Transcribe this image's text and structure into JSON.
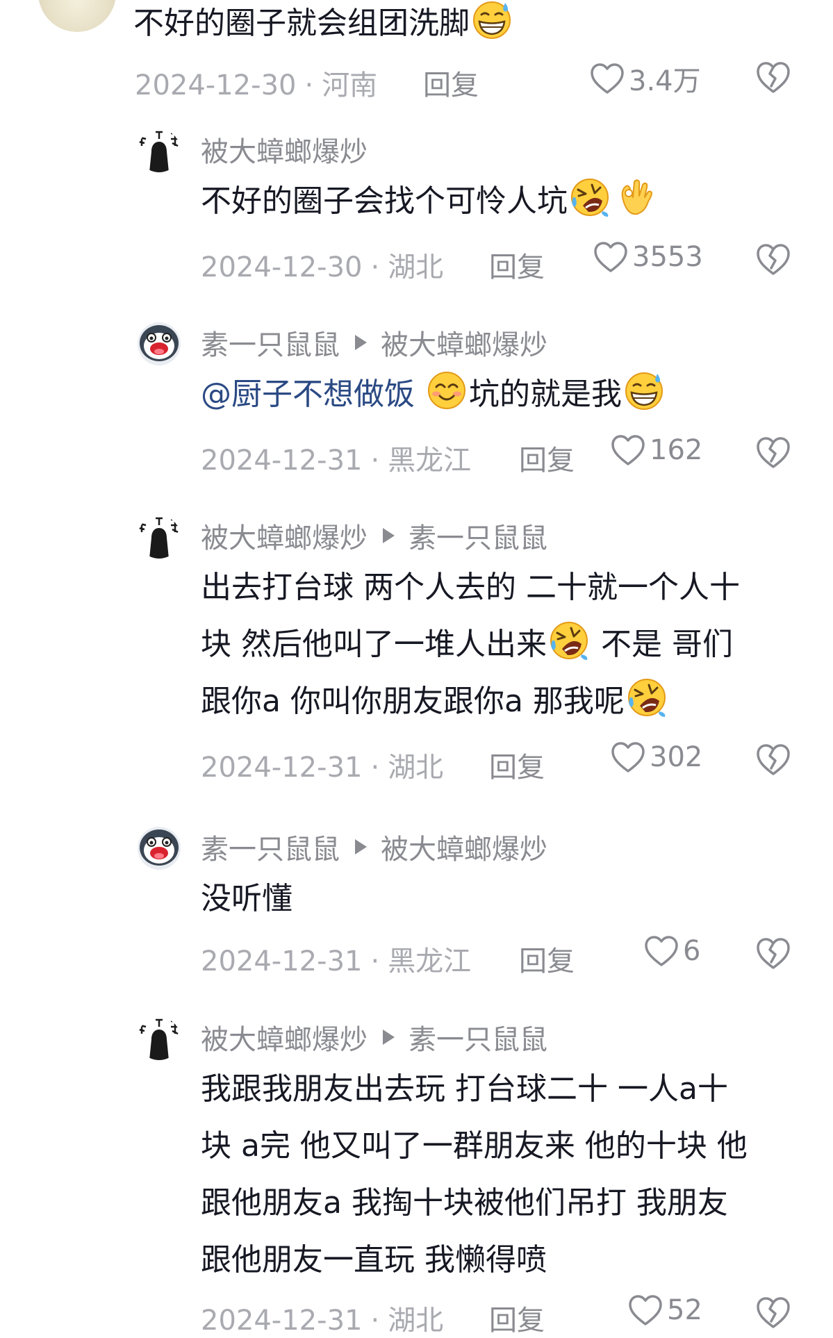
{
  "comments": [
    {
      "author": "",
      "reply_to": "",
      "text": "不好的圈子就会组团洗脚",
      "emojis": [
        "sweat-grin-emoji"
      ],
      "date": "2024-12-30",
      "location": "河南",
      "reply_label": "回复",
      "likes": "3.4万"
    },
    {
      "author": "被大蟑螂爆炒",
      "reply_to": "",
      "text": "不好的圈子会找个可怜人坑",
      "emojis": [
        "rofl-emoji",
        "ok-hand-emoji"
      ],
      "date": "2024-12-30",
      "location": "湖北",
      "reply_label": "回复",
      "likes": "3553"
    },
    {
      "author": "素一只鼠鼠",
      "reply_to": "被大蟑螂爆炒",
      "mention": "@厨子不想做饭",
      "text": "坑的就是我",
      "emojis": [
        "blush-smile-emoji",
        "sweat-grin-emoji"
      ],
      "date": "2024-12-31",
      "location": "黑龙江",
      "reply_label": "回复",
      "likes": "162"
    },
    {
      "author": "被大蟑螂爆炒",
      "reply_to": "素一只鼠鼠",
      "lines": [
        "出去打台球 两个人去的 二十就一个人十",
        "块 然后他叫了一堆人出来",
        " 不是 哥们",
        "跟你a 你叫你朋友跟你a 那我呢"
      ],
      "emojis": [
        "rofl-emoji",
        "rofl-emoji"
      ],
      "date": "2024-12-31",
      "location": "湖北",
      "reply_label": "回复",
      "likes": "302"
    },
    {
      "author": "素一只鼠鼠",
      "reply_to": "被大蟑螂爆炒",
      "text": "没听懂",
      "date": "2024-12-31",
      "location": "黑龙江",
      "reply_label": "回复",
      "likes": "6"
    },
    {
      "author": "被大蟑螂爆炒",
      "reply_to": "素一只鼠鼠",
      "lines": [
        "我跟我朋友出去玩 打台球二十 一人a十",
        "块 a完 他又叫了一群朋友来 他的十块 他",
        "跟他朋友a 我掏十块被他们吊打 我朋友",
        "跟他朋友一直玩 我懒得喷"
      ],
      "date": "2024-12-31",
      "location": "湖北",
      "reply_label": "回复",
      "likes": "52"
    }
  ],
  "separator": "·",
  "colors": {
    "text": "#161823",
    "secondary": "#8a8b91",
    "date": "#a9aab0",
    "mention": "#2b4a84"
  }
}
